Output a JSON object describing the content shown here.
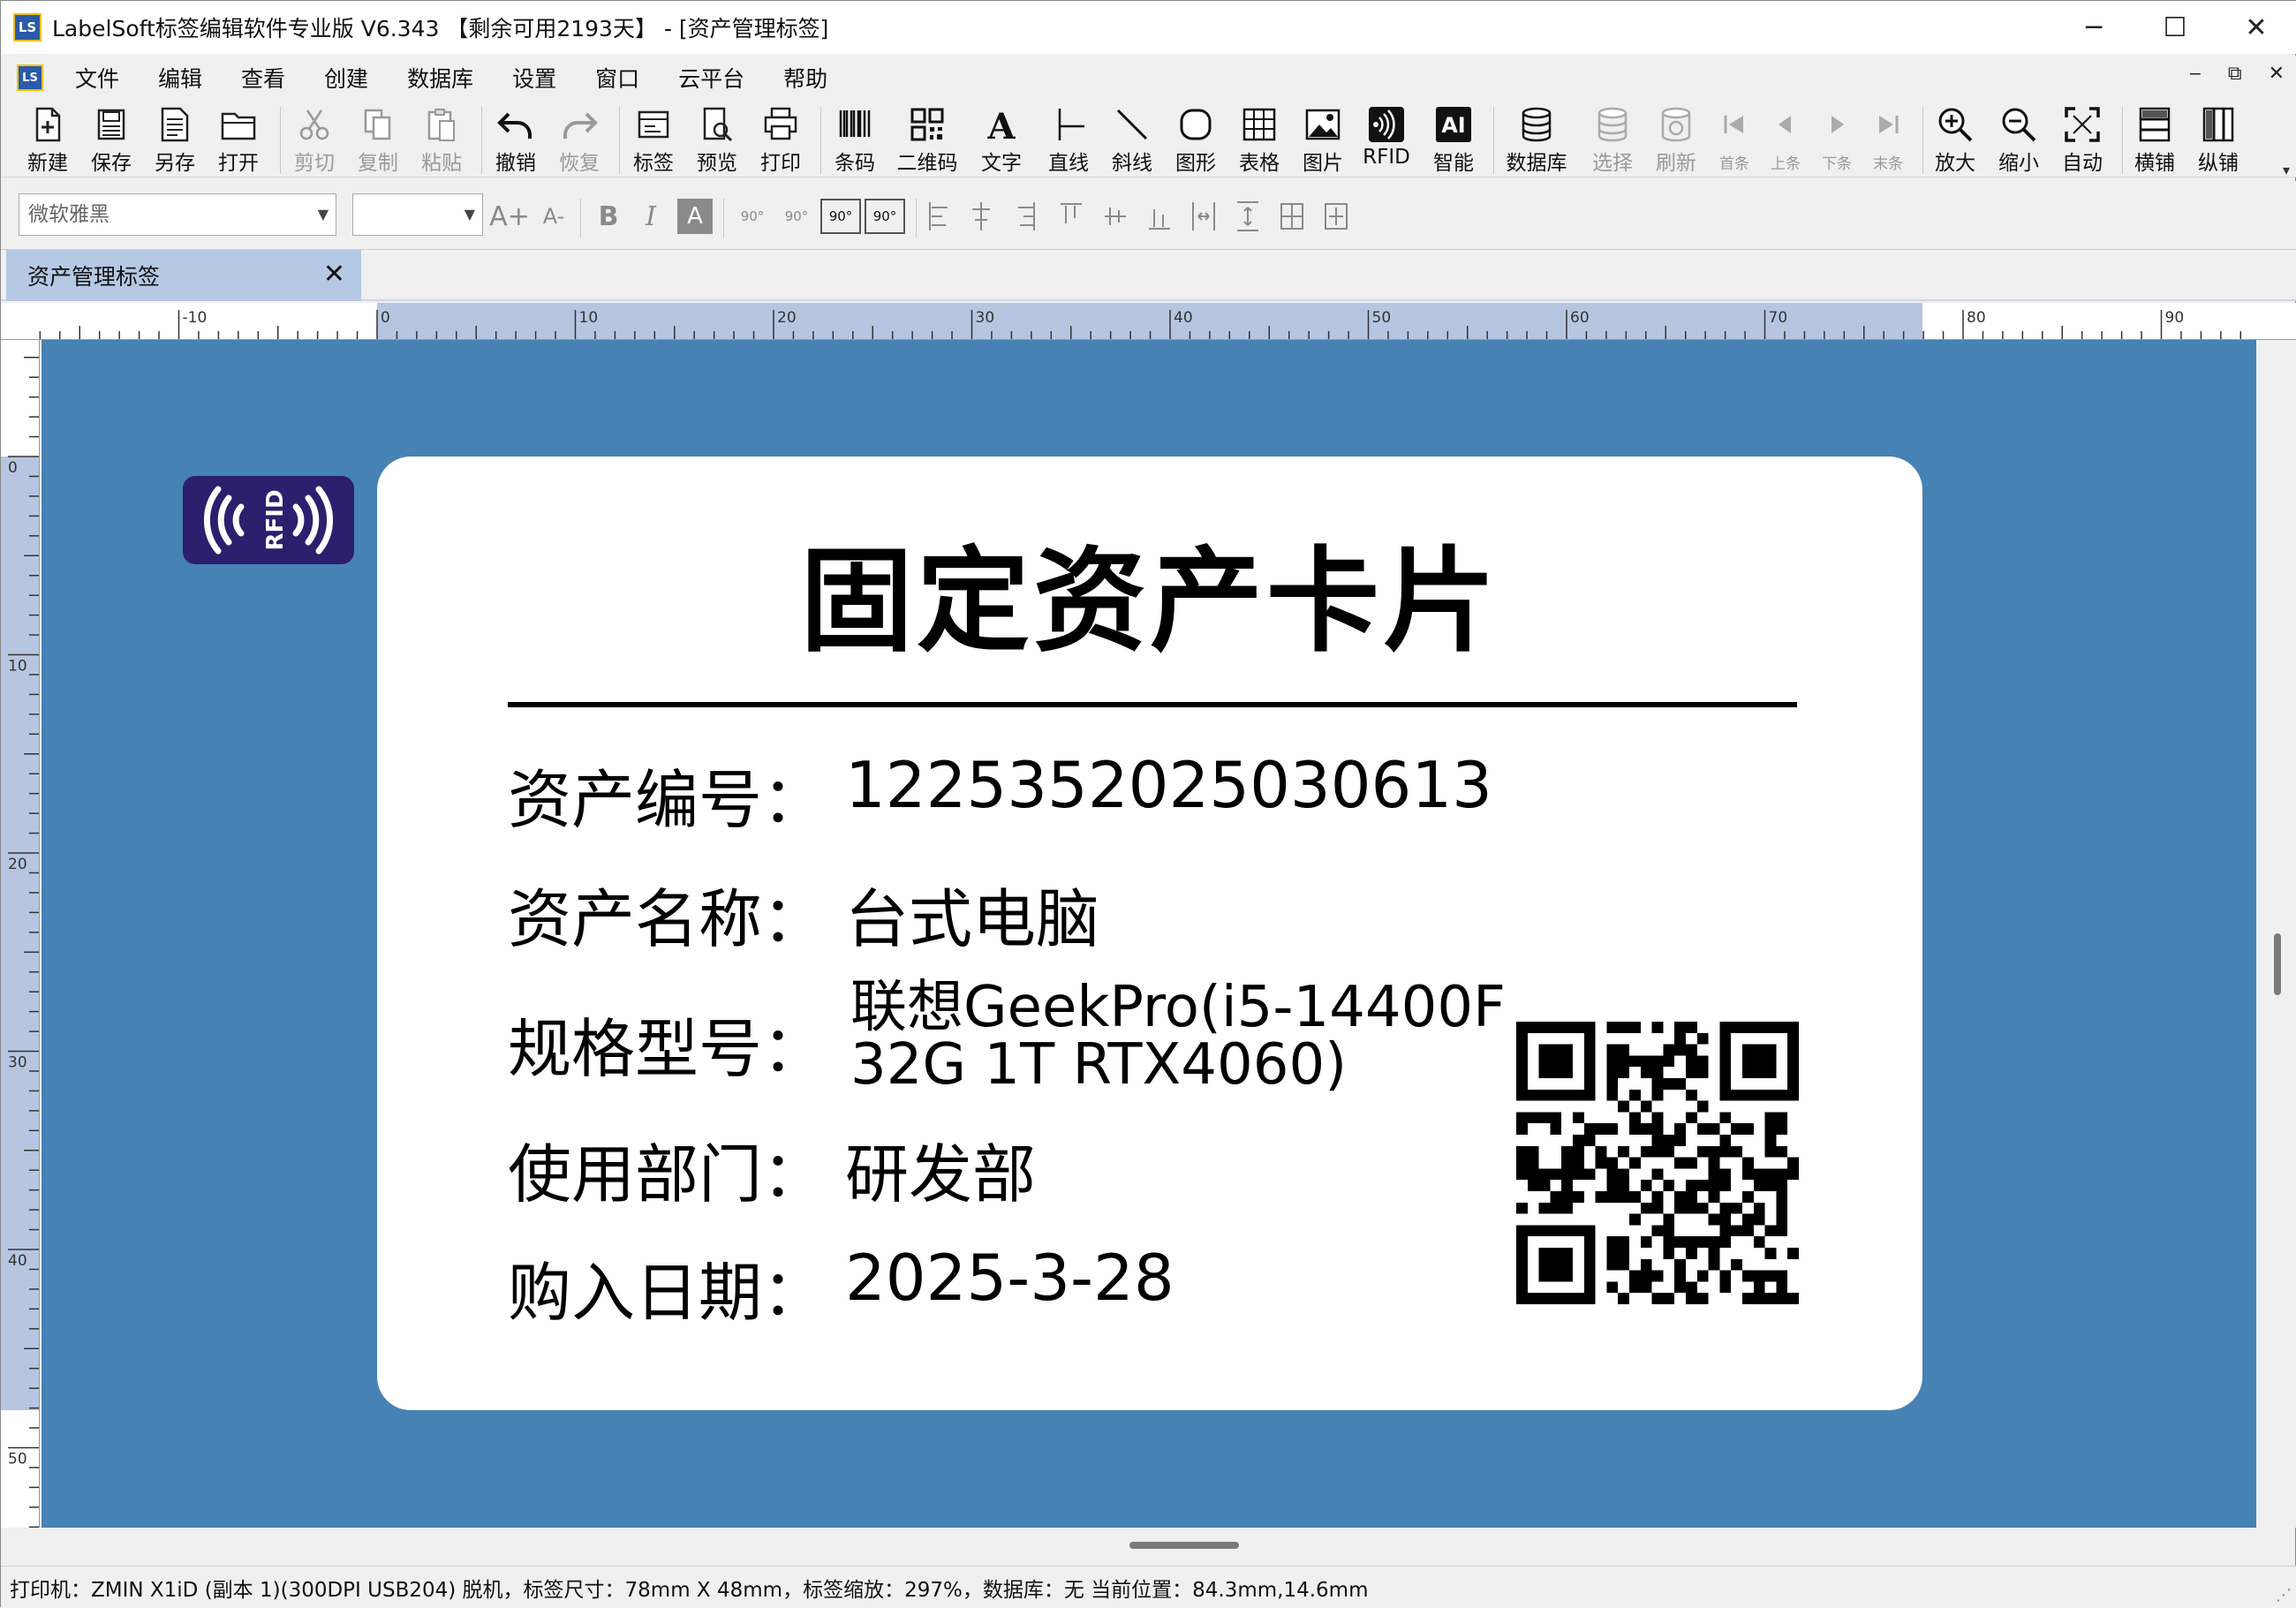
{
  "window": {
    "title": "LabelSoft标签编辑软件专业版 V6.343 【剩余可用2193天】 - [资产管理标签]",
    "logo_text": "LS",
    "buttons": [
      "─",
      "☐",
      "✕"
    ]
  },
  "menu": {
    "items": [
      "文件",
      "编辑",
      "查看",
      "创建",
      "数据库",
      "设置",
      "窗口",
      "云平台",
      "帮助"
    ],
    "mdi_buttons": [
      "‒",
      "⧉",
      "✕"
    ]
  },
  "toolbar": {
    "buttons": [
      {
        "label": "新建",
        "icon": "new-file-icon"
      },
      {
        "label": "保存",
        "icon": "save-icon"
      },
      {
        "label": "另存",
        "icon": "save-as-icon"
      },
      {
        "label": "打开",
        "icon": "open-folder-icon"
      },
      {
        "label": "剪切",
        "icon": "scissors-icon"
      },
      {
        "label": "复制",
        "icon": "copy-icon"
      },
      {
        "label": "粘贴",
        "icon": "paste-icon"
      },
      {
        "label": "撤销",
        "icon": "undo-icon"
      },
      {
        "label": "恢复",
        "icon": "redo-icon"
      },
      {
        "label": "标签",
        "icon": "label-icon"
      },
      {
        "label": "预览",
        "icon": "preview-icon"
      },
      {
        "label": "打印",
        "icon": "printer-icon"
      },
      {
        "label": "条码",
        "icon": "barcode-icon"
      },
      {
        "label": "二维码",
        "icon": "qrcode-icon"
      },
      {
        "label": "文字",
        "icon": "text-icon"
      },
      {
        "label": "直线",
        "icon": "line-icon"
      },
      {
        "label": "斜线",
        "icon": "diagonal-line-icon"
      },
      {
        "label": "图形",
        "icon": "shape-icon"
      },
      {
        "label": "表格",
        "icon": "table-icon"
      },
      {
        "label": "图片",
        "icon": "image-icon"
      },
      {
        "label": "RFID",
        "icon": "rfid-icon"
      },
      {
        "label": "智能",
        "icon": "ai-icon"
      },
      {
        "label": "数据库",
        "icon": "database-icon"
      },
      {
        "label": "选择",
        "icon": "database-select-icon"
      },
      {
        "label": "刷新",
        "icon": "database-refresh-icon"
      },
      {
        "label": "首条",
        "icon": "first-record-icon"
      },
      {
        "label": "上条",
        "icon": "prev-record-icon"
      },
      {
        "label": "下条",
        "icon": "next-record-icon"
      },
      {
        "label": "末条",
        "icon": "last-record-icon"
      },
      {
        "label": "放大",
        "icon": "zoom-in-icon"
      },
      {
        "label": "缩小",
        "icon": "zoom-out-icon"
      },
      {
        "label": "自动",
        "icon": "zoom-fit-icon"
      },
      {
        "label": "横铺",
        "icon": "tile-horizontal-icon"
      },
      {
        "label": "纵铺",
        "icon": "tile-vertical-icon"
      }
    ]
  },
  "format": {
    "font_name": "微软雅黑",
    "font_size": "",
    "buttons": [
      "A+",
      "A-",
      "B",
      "I",
      "A",
      "90°",
      "90°",
      "90°",
      "90°"
    ]
  },
  "tab": {
    "label": "资产管理标签",
    "close": "✕"
  },
  "ruler": {
    "top_labels": [
      "-10",
      "0",
      "10",
      "20",
      "30",
      "40",
      "50",
      "60",
      "70",
      "80",
      "90"
    ],
    "left_labels": [
      "0",
      "10",
      "20",
      "30",
      "40",
      "50"
    ]
  },
  "label": {
    "rfid_text": "RFID",
    "title": "固定资产卡片",
    "fields": [
      {
        "label": "资产编号：",
        "value": "1225352025030613"
      },
      {
        "label": "资产名称：",
        "value": "台式电脑"
      },
      {
        "label": "规格型号：",
        "value": "联想GeekPro(i5-14400F",
        "value2": " 32G 1T RTX4060)"
      },
      {
        "label": "使用部门：",
        "value": "研发部"
      },
      {
        "label": "购入日期：",
        "value": "2025-3-28"
      }
    ]
  },
  "status": {
    "text": "打印机：ZMIN X1iD (副本 1)(300DPI USB204) 脱机，标签尺寸：78mm X 48mm，标签缩放：297%，数据库：无  当前位置：84.3mm,14.6mm"
  }
}
